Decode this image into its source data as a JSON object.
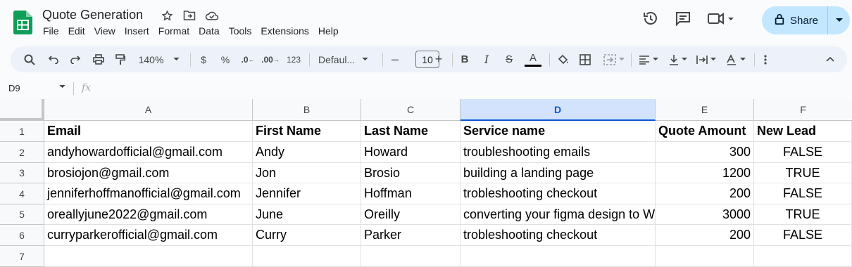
{
  "app": {
    "doc_title": "Quote Generation",
    "menu": [
      "File",
      "Edit",
      "View",
      "Insert",
      "Format",
      "Data",
      "Tools",
      "Extensions",
      "Help"
    ],
    "share_label": "Share",
    "brand_color": "#0f9d58",
    "accent_color": "#c2e7ff"
  },
  "toolbar": {
    "zoom": "140%",
    "currency": "$",
    "percent": "%",
    "dec_decrease": ".0",
    "dec_increase": ".00",
    "number_format": "123",
    "font": "Defaul...",
    "font_size": "10"
  },
  "formula_bar": {
    "cell_ref": "D9",
    "fx": "fx",
    "value": ""
  },
  "sheet": {
    "columns": [
      "A",
      "B",
      "C",
      "D",
      "E",
      "F"
    ],
    "selected_column": "D",
    "row_numbers": [
      "1",
      "2",
      "3",
      "4",
      "5",
      "6",
      "7"
    ],
    "rows": [
      [
        "Email",
        "First Name",
        "Last Name",
        "Service name",
        "Quote Amount",
        "New Lead"
      ],
      [
        "andyhowardofficial@gmail.com",
        "Andy",
        "Howard",
        "troubleshooting emails",
        "300",
        "FALSE"
      ],
      [
        "brosiojon@gmail.com",
        "Jon",
        "Brosio",
        "building a landing page",
        "1200",
        "TRUE"
      ],
      [
        "jenniferhoffmanofficial@gmail.com",
        "Jennifer",
        "Hoffman",
        "trobleshooting checkout",
        "200",
        "FALSE"
      ],
      [
        "oreallyjune2022@gmail.com",
        "June",
        "Oreilly",
        "converting your figma design to W",
        "3000",
        "TRUE"
      ],
      [
        "curryparkerofficial@gmail.com",
        "Curry",
        "Parker",
        "trobleshooting checkout",
        "200",
        "FALSE"
      ],
      [
        "",
        "",
        "",
        "",
        "",
        ""
      ]
    ]
  }
}
